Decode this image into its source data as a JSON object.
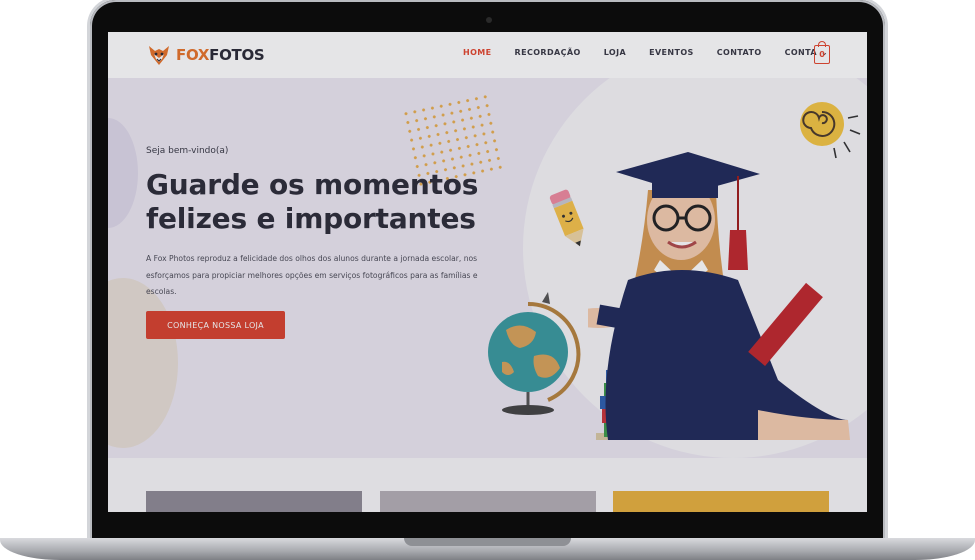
{
  "header": {
    "logo": {
      "part1": "FOX",
      "part2": "FOTOS"
    },
    "nav": [
      {
        "label": "HOME",
        "active": true
      },
      {
        "label": "RECORDAÇÃO",
        "active": false
      },
      {
        "label": "LOJA",
        "active": false
      },
      {
        "label": "EVENTOS",
        "active": false
      },
      {
        "label": "CONTATO",
        "active": false
      },
      {
        "label": "CONTA",
        "active": false
      }
    ],
    "cart_count": "0"
  },
  "hero": {
    "welcome": "Seja bem-vindo(a)",
    "headline": "Guarde os momentos felizes e importantes",
    "description": "A Fox Photos reproduz a felicidade dos olhos dos alunos durante a jornada escolar, nos esforçamos para propiciar melhores opções em serviços fotográficos para as famílias e escolas.",
    "cta_label": "CONHEÇA NOSSA LOJA"
  },
  "colors": {
    "accent": "#d9412e",
    "brand_orange": "#e8732a",
    "hero_bg": "#ece8f2",
    "dark_text": "#2c2c38"
  },
  "icons": [
    "fox-logo-icon",
    "cart-icon",
    "chevron-down-icon",
    "sun-icon",
    "pencil-icon",
    "globe-icon"
  ]
}
